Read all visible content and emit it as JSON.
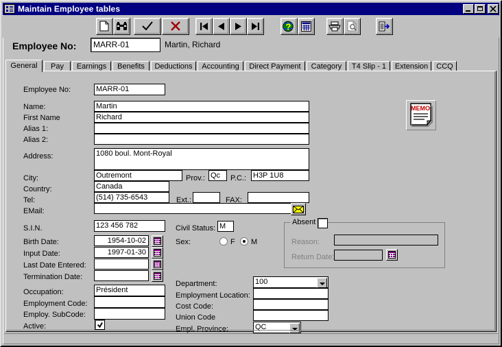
{
  "window": {
    "title": "Maintain Employee tables",
    "icon": "table-window-icon",
    "controls": {
      "minimize": "minimize-button",
      "maximize": "maximize-button",
      "close": "close-button"
    }
  },
  "toolbar": {
    "buttons": [
      {
        "name": "new-record-button",
        "icon": "new-document-icon",
        "tooltip": "New"
      },
      {
        "name": "find-record-button",
        "icon": "binoculars-icon",
        "tooltip": "Find"
      },
      {
        "name": "accept-button",
        "icon": "checkmark-icon",
        "tooltip": "Accept"
      },
      {
        "name": "delete-button",
        "icon": "red-x-icon",
        "tooltip": "Delete"
      },
      {
        "name": "first-record-button",
        "icon": "first-record-icon",
        "tooltip": "First"
      },
      {
        "name": "previous-record-button",
        "icon": "previous-record-icon",
        "tooltip": "Previous"
      },
      {
        "name": "next-record-button",
        "icon": "next-record-icon",
        "tooltip": "Next"
      },
      {
        "name": "last-record-button",
        "icon": "last-record-icon",
        "tooltip": "Last"
      },
      {
        "name": "help-button",
        "icon": "globe-question-icon",
        "tooltip": "Help"
      },
      {
        "name": "calculator-button",
        "icon": "grid-table-icon",
        "tooltip": "Table"
      },
      {
        "name": "print-button",
        "icon": "printer-icon",
        "tooltip": "Print"
      },
      {
        "name": "print-preview-button",
        "icon": "print-preview-icon",
        "tooltip": "Preview"
      },
      {
        "name": "exit-button",
        "icon": "exit-door-icon",
        "tooltip": "Exit"
      }
    ]
  },
  "header": {
    "employee_no_label": "Employee No:",
    "employee_no_value": "MARR-01",
    "employee_name": "Martin, Richard"
  },
  "tabs": {
    "active_index": 0,
    "items": [
      {
        "label": "General"
      },
      {
        "label": "Pay"
      },
      {
        "label": "Earnings"
      },
      {
        "label": "Benefits"
      },
      {
        "label": "Deductions"
      },
      {
        "label": "Accounting"
      },
      {
        "label": "Direct Payment"
      },
      {
        "label": "Category"
      },
      {
        "label": "T4 Slip - 1"
      },
      {
        "label": "Extension"
      },
      {
        "label": "CCQ"
      }
    ]
  },
  "general": {
    "employee_no": {
      "label": "Employee No:",
      "value": "MARR-01"
    },
    "name": {
      "label": "Name:",
      "value": "Martin"
    },
    "first_name": {
      "label": "First Name",
      "value": "Richard"
    },
    "alias1": {
      "label": "Alias 1:",
      "value": ""
    },
    "alias2": {
      "label": "Alias 2:",
      "value": ""
    },
    "address": {
      "label": "Address:",
      "value": "1080 boul. Mont-Royal"
    },
    "city": {
      "label": "City:",
      "value": "Outremont"
    },
    "prov": {
      "label": "Prov.:",
      "value": "Qc"
    },
    "postal_code": {
      "label": "P.C.:",
      "value": "H3P 1U8"
    },
    "country": {
      "label": "Country:",
      "value": "Canada"
    },
    "tel": {
      "label": "Tel:",
      "value": "(514) 735-6543"
    },
    "ext": {
      "label": "Ext.:",
      "value": ""
    },
    "fax": {
      "label": "FAX:",
      "value": ""
    },
    "email": {
      "label": "EMail:",
      "value": ""
    },
    "email_button_icon": "envelope-icon",
    "memo_button_icon": "memo-note-icon",
    "memo_button_text": "MEMO",
    "sin": {
      "label": "S.I.N.",
      "value": "123 456 782"
    },
    "birth_date": {
      "label": "Birth Date:",
      "value": "1954-10-02"
    },
    "input_date": {
      "label": "Input Date:",
      "value": "1997-01-30"
    },
    "last_date_entered": {
      "label": "Last Date Entered:",
      "value": ""
    },
    "termination_date": {
      "label": "Termination Date:",
      "value": ""
    },
    "civil_status": {
      "label": "Civil Status:",
      "value": "M"
    },
    "sex": {
      "label": "Sex:",
      "options": [
        {
          "label": "F",
          "selected": false
        },
        {
          "label": "M",
          "selected": true
        }
      ]
    },
    "absent": {
      "label": "Absent",
      "checked": false,
      "reason": {
        "label": "Reason:",
        "value": ""
      },
      "return_date": {
        "label": "Return Date:",
        "value": ""
      }
    },
    "occupation": {
      "label": "Occupation:",
      "value": "Président"
    },
    "employment_code": {
      "label": "Employment Code:",
      "value": ""
    },
    "employ_subcode": {
      "label": "Employ. SubCode:",
      "value": ""
    },
    "active": {
      "label": "Active:",
      "checked": true
    },
    "department": {
      "label": "Department:",
      "value": "100"
    },
    "employment_location": {
      "label": "Employment Location:",
      "value": ""
    },
    "cost_code": {
      "label": "Cost Code:",
      "value": ""
    },
    "union_code": {
      "label": "Union Code",
      "value": ""
    },
    "empl_province": {
      "label": "Empl. Province:",
      "value": "QC"
    }
  },
  "colors": {
    "face": "#c0c0c0",
    "titlebar": "#000080",
    "field": "#ffffff",
    "accent_purple": "#800080",
    "accent_yellow": "#ffff00",
    "delete_red": "#a00000",
    "disabled_text": "#808080"
  }
}
